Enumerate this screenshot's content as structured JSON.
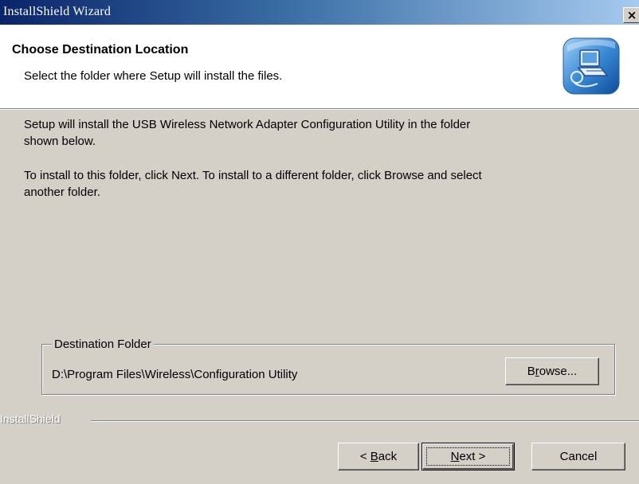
{
  "window": {
    "title": "InstallShield Wizard",
    "close_glyph": "×"
  },
  "header": {
    "title": "Choose Destination Location",
    "subtitle": "Select the folder where Setup will install the files.",
    "icon": "setup-computer-icon"
  },
  "body": {
    "paragraph1_line1": "Setup will install the USB Wireless Network Adapter Configuration Utility in the folder",
    "paragraph1_line2": "shown below.",
    "paragraph2_line1": "To install to this folder, click Next. To install to a different folder, click Browse and select",
    "paragraph2_line2": "another folder."
  },
  "destination": {
    "group_label": "Destination Folder",
    "path": "D:\\Program Files\\Wireless\\Configuration Utility",
    "browse": {
      "before": "B",
      "mnemonic": "r",
      "after": "owse..."
    }
  },
  "footer": {
    "brand": "InstallShield",
    "back": {
      "prefix": "< ",
      "mnemonic": "B",
      "after": "ack"
    },
    "next": {
      "mnemonic": "N",
      "after": "ext >"
    },
    "cancel": "Cancel"
  },
  "colors": {
    "title_gradient_start": "#0a246a",
    "title_gradient_end": "#a6caf0",
    "dialog_face": "#d4d0c8",
    "header_background": "#ffffff"
  }
}
